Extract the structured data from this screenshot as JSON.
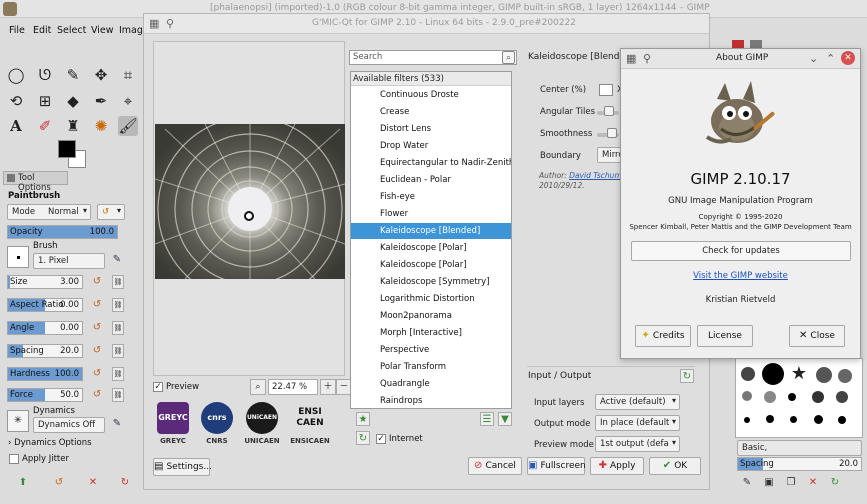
{
  "gimp": {
    "window_title": "[phalaenopsi] (imported)-1.0 (RGB colour 8-bit gamma integer, GIMP built-in sRGB, 1 layer) 1264x1144 – GIMP",
    "menu": [
      "File",
      "Edit",
      "Select",
      "View",
      "Imag"
    ],
    "tool_options_tab": "Tool Options",
    "tool_name": "Paintbrush",
    "mode_label": "Mode",
    "mode_value": "Normal",
    "opacity": {
      "label": "Opacity",
      "value": "100.0",
      "fraction": 1.0
    },
    "brush_label": "Brush",
    "brush_value": "1. Pixel",
    "size": {
      "label": "Size",
      "value": "3.00",
      "fraction": 0.03
    },
    "aspect": {
      "label": "Aspect Ratio",
      "value": "0.00",
      "fraction": 0.5
    },
    "angle": {
      "label": "Angle",
      "value": "0.00",
      "fraction": 0.5
    },
    "spacing": {
      "label": "Spacing",
      "value": "20.0",
      "fraction": 0.2
    },
    "hardness": {
      "label": "Hardness",
      "value": "100.0",
      "fraction": 1.0
    },
    "force": {
      "label": "Force",
      "value": "50.0",
      "fraction": 0.5
    },
    "dynamics_label": "Dynamics",
    "dynamics_value": "Dynamics Off",
    "dynamics_options": "Dynamics Options",
    "apply_jitter": "Apply Jitter",
    "dock_brush_preset": "Basic,",
    "dock_spacing": {
      "label": "Spacing",
      "value": "20.0",
      "fraction": 0.2
    }
  },
  "gmic": {
    "window_title": "G'MIC-Qt for GIMP 2.10 - Linux 64 bits - 2.9.0_pre#200222",
    "preview_label": "Preview",
    "zoom_value": "22.47 %",
    "logos": [
      "GREYC",
      "CNRS",
      "UNICAEN",
      "ENSICAEN"
    ],
    "logo_marks": [
      "GREYC",
      "cnrs",
      "UNiCAEN",
      "ENSI CAEN"
    ],
    "settings_button": "Settings...",
    "search_placeholder": "Search",
    "filters_header": "Available filters (533)",
    "filters": [
      "Continuous Droste",
      "Crease",
      "Distort Lens",
      "Drop Water",
      "Equirectangular to Nadir-Zenith",
      "Euclidean - Polar",
      "Fish-eye",
      "Flower",
      "Kaleidoscope [Blended]",
      "Kaleidoscope [Polar]",
      "Kaleidoscope [Polar]",
      "Kaleidoscope [Symmetry]",
      "Logarithmic Distortion",
      "Moon2panorama",
      "Morph [Interactive]",
      "Perspective",
      "Polar Transform",
      "Quadrangle",
      "Raindrops"
    ],
    "selected_filter_index": 8,
    "internet_label": "Internet",
    "params_title": "Kaleidoscope [Blended]",
    "param_center": "Center (%)",
    "param_center_x": "X",
    "param_angular": "Angular Tiles",
    "param_smooth": "Smoothness",
    "param_boundary": "Boundary",
    "param_boundary_value": "Mirro",
    "author_prefix": "Author:",
    "author_name": "David Tschump",
    "author_date": "2010/29/12.",
    "io_title": "Input / Output",
    "input_layers_label": "Input layers",
    "input_layers_value": "Active (default)",
    "output_mode_label": "Output mode",
    "output_mode_value": "In place (default",
    "preview_mode_label": "Preview mode",
    "preview_mode_value": "1st output (defa",
    "cancel_button": "Cancel",
    "fullscreen_button": "Fullscreen",
    "apply_button": "Apply",
    "ok_button": "OK"
  },
  "about": {
    "title": "About GIMP",
    "version": "GIMP 2.10.17",
    "description": "GNU Image Manipulation Program",
    "copyright_line1": "Copyright © 1995-2020",
    "copyright_line2": "Spencer Kimball, Peter Mattis and the GIMP Development Team",
    "update_button": "Check for updates",
    "website_link": "Visit the GIMP website",
    "author": "Kristian Rietveld",
    "credits_button": "Credits",
    "license_button": "License",
    "close_button": "Close"
  },
  "colors": {
    "selection": "#3d95d8",
    "slider_fill": "#6b9bd1",
    "link": "#1b4fc2"
  }
}
